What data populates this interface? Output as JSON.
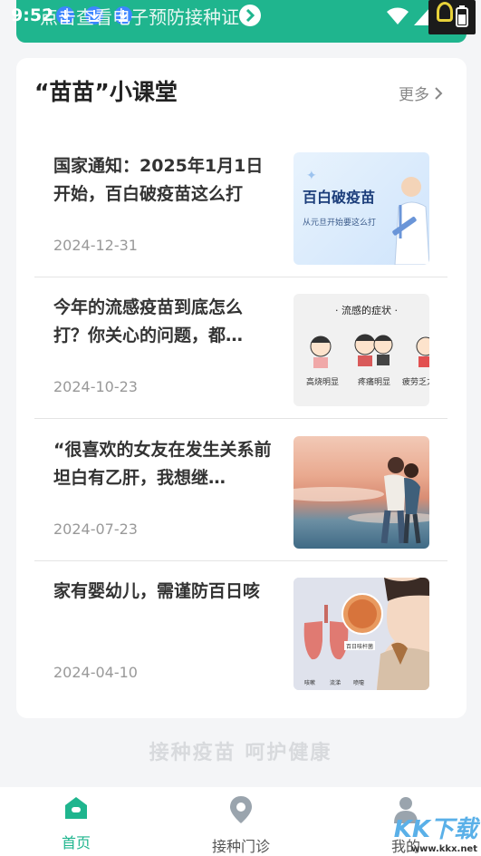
{
  "status_bar": {
    "time": "9:52"
  },
  "banner": {
    "text": "点击查看电子预防接种证"
  },
  "section": {
    "title": "“苗苗”小课堂",
    "more_label": "更多"
  },
  "articles": [
    {
      "title": "国家通知：2025年1月1日开始，百白破疫苗这么打",
      "date": "2024-12-31",
      "thumb": {
        "heading": "百白破疫苗",
        "sub": "从元旦开始要这么打"
      }
    },
    {
      "title": "今年的流感疫苗到底怎么打？你关心的问题，都…",
      "date": "2024-10-23",
      "thumb": {
        "heading": "· 流感的症状 ·",
        "labels": [
          "高烧明显",
          "疼痛明显",
          "疲劳乏力"
        ]
      }
    },
    {
      "title": "“很喜欢的女友在发生关系前坦白有乙肝，我想继…",
      "date": "2024-07-23",
      "thumb": {}
    },
    {
      "title": "家有婴幼儿，需谨防百日咳",
      "date": "2024-04-10",
      "thumb": {
        "caption": "百日咳杆菌",
        "labels": [
          "咳嗽",
          "流涕",
          "喷嚏"
        ]
      }
    }
  ],
  "slogan": "接种疫苗  呵护健康",
  "nav": {
    "home": "首页",
    "clinic": "接种门诊",
    "mine": "我的"
  },
  "watermark": {
    "brand": "KK下载",
    "url": "www.kkx.net"
  },
  "colors": {
    "accent": "#1fb58e",
    "text": "#333333",
    "muted": "#999999"
  }
}
